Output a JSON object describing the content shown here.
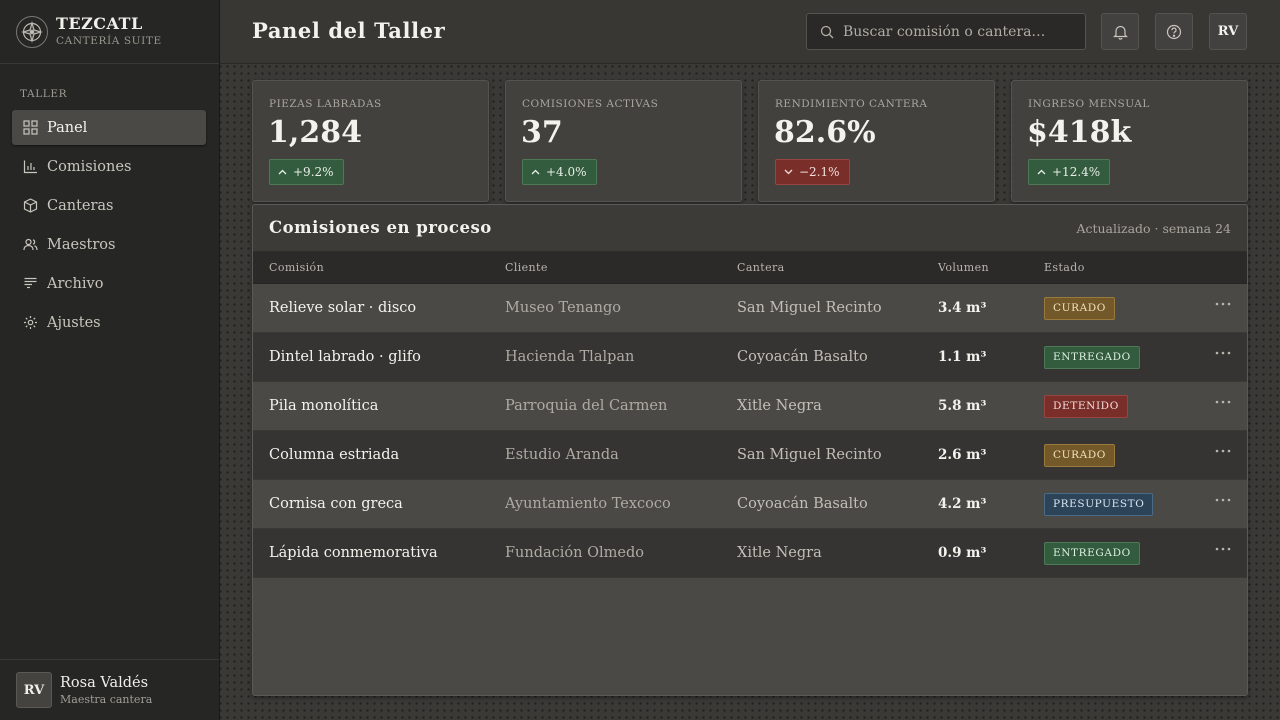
{
  "brand": {
    "name": "TEZCATL",
    "subtitle": "Cantería Suite"
  },
  "sidebar": {
    "section_label": "Taller",
    "items": [
      {
        "label": "Panel",
        "icon": "grid-icon",
        "active": true
      },
      {
        "label": "Comisiones",
        "icon": "bar-chart-icon",
        "active": false
      },
      {
        "label": "Canteras",
        "icon": "cube-icon",
        "active": false
      },
      {
        "label": "Maestros",
        "icon": "users-icon",
        "active": false
      },
      {
        "label": "Archivo",
        "icon": "archive-icon",
        "active": false
      },
      {
        "label": "Ajustes",
        "icon": "gear-icon",
        "active": false
      }
    ]
  },
  "user": {
    "initials": "RV",
    "name": "Rosa Valdés",
    "role": "Maestra cantera"
  },
  "header": {
    "title": "Panel del Taller",
    "search_placeholder": "Buscar comisión o cantera…",
    "avatar_initials": "RV"
  },
  "stats": [
    {
      "label": "Piezas labradas",
      "value": "1,284",
      "delta": "+9.2%",
      "trend": "up"
    },
    {
      "label": "Comisiones activas",
      "value": "37",
      "delta": "+4.0%",
      "trend": "up"
    },
    {
      "label": "Rendimiento cantera",
      "value": "82.6%",
      "delta": "−2.1%",
      "trend": "down"
    },
    {
      "label": "Ingreso mensual",
      "value": "$418k",
      "delta": "+12.4%",
      "trend": "up"
    }
  ],
  "table": {
    "title": "Comisiones en proceso",
    "updated": "Actualizado · semana 24",
    "columns": [
      "Comisión",
      "Cliente",
      "Cantera",
      "Volumen",
      "Estado"
    ],
    "rows": [
      {
        "comision": "Relieve solar · disco",
        "cliente": "Museo Tenango",
        "cantera": "San Miguel Recinto",
        "volumen": "3.4 m³",
        "estado": "Curado",
        "estado_key": "curado"
      },
      {
        "comision": "Dintel labrado · glifo",
        "cliente": "Hacienda Tlalpan",
        "cantera": "Coyoacán Basalto",
        "volumen": "1.1 m³",
        "estado": "Entregado",
        "estado_key": "entregado"
      },
      {
        "comision": "Pila monolítica",
        "cliente": "Parroquia del Carmen",
        "cantera": "Xitle Negra",
        "volumen": "5.8 m³",
        "estado": "Detenido",
        "estado_key": "detenido"
      },
      {
        "comision": "Columna estriada",
        "cliente": "Estudio Aranda",
        "cantera": "San Miguel Recinto",
        "volumen": "2.6 m³",
        "estado": "Curado",
        "estado_key": "curado"
      },
      {
        "comision": "Cornisa con greca",
        "cliente": "Ayuntamiento Texcoco",
        "cantera": "Coyoacán Basalto",
        "volumen": "4.2 m³",
        "estado": "Presupuesto",
        "estado_key": "presupuesto"
      },
      {
        "comision": "Lápida conmemorativa",
        "cliente": "Fundación Olmedo",
        "cantera": "Xitle Negra",
        "volumen": "0.9 m³",
        "estado": "Entregado",
        "estado_key": "entregado"
      }
    ]
  },
  "colors": {
    "positive": "#335b3d",
    "negative": "#7a2e29",
    "warning": "#73582a",
    "info": "#2c4358"
  }
}
